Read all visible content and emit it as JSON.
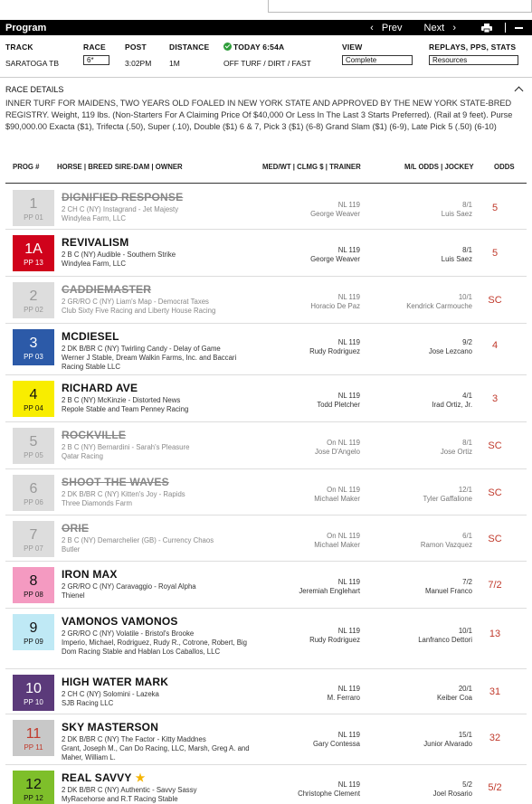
{
  "header": {
    "program_label": "Program",
    "prev_label": "Prev",
    "next_label": "Next"
  },
  "race_info": {
    "track_label": "TRACK",
    "track_value": "SARATOGA TB",
    "race_label": "RACE",
    "race_value": "6*",
    "post_label": "POST",
    "post_value": "3:02PM",
    "distance_label": "DISTANCE",
    "distance_value": "1M",
    "today_label": "TODAY 6:54A",
    "surface_value": "OFF TURF / DIRT / FAST",
    "view_label": "VIEW",
    "view_value": "Complete",
    "replays_label": "REPLAYS, PPS, STATS",
    "replays_value": "Resources"
  },
  "race_details": {
    "title": "RACE DETAILS",
    "text": "INNER TURF FOR MAIDENS, TWO YEARS OLD FOALED IN NEW YORK STATE AND APPROVED BY THE NEW YORK STATE-BRED REGISTRY. Weight, 119 lbs. (Non-Starters For A Claiming Price Of $40,000 Or Less In The Last 3 Starts Preferred). (Rail at 9 feet). Purse $90,000.00 Exacta ($1), Trifecta (.50), Super (.10), Double ($1) 6 & 7, Pick 3 ($1) (6-8) Grand Slam ($1) (6-9), Late Pick 5 (.50) (6-10)"
  },
  "table": {
    "col_prog": "PROG #",
    "col_horse": "HORSE | BREED SIRE-DAM | OWNER",
    "col_med": "MED/WT | CLMG $ | TRAINER",
    "col_ml": "M/L ODDS | JOCKEY",
    "col_odds": "ODDS"
  },
  "entries": [
    {
      "num": "1",
      "pp": "PP 01",
      "name": "DIGNIFIED RESPONSE",
      "breed": "2 CH C (NY) Instagrand - Jet Majesty",
      "owner": "Windylea Farm, LLC",
      "medwt": "NL 119",
      "trainer": "George Weaver",
      "ml": "8/1",
      "jockey": "Luis Saez",
      "odds": "5",
      "scratched": true,
      "color": "#ddd",
      "text": "#999"
    },
    {
      "num": "1A",
      "pp": "PP 13",
      "name": "REVIVALISM",
      "breed": "2 B C (NY) Audible - Southern Strike",
      "owner": "Windylea Farm, LLC",
      "medwt": "NL 119",
      "trainer": "George Weaver",
      "ml": "8/1",
      "jockey": "Luis Saez",
      "odds": "5",
      "scratched": false,
      "color": "#d0021b",
      "text": "#fff"
    },
    {
      "num": "2",
      "pp": "PP 02",
      "name": "CADDIEMASTER",
      "breed": "2 GR/RO C (NY) Liam's Map - Democrat Taxes",
      "owner": "Club Sixty Five Racing and Liberty House Racing",
      "medwt": "NL 119",
      "trainer": "Horacio De Paz",
      "ml": "10/1",
      "jockey": "Kendrick Carmouche",
      "odds": "SC",
      "scratched": true,
      "color": "#ddd",
      "text": "#999"
    },
    {
      "num": "3",
      "pp": "PP 03",
      "name": "MCDIESEL",
      "breed": "2 DK B/BR C (NY) Twirling Candy - Delay of Game",
      "owner": "Werner J Stable, Dream Walkin Farms, Inc. and Baccari Racing Stable LLC",
      "medwt": "NL 119",
      "trainer": "Rudy Rodriguez",
      "ml": "9/2",
      "jockey": "Jose Lezcano",
      "odds": "4",
      "scratched": false,
      "color": "#2c5aa8",
      "text": "#fff"
    },
    {
      "num": "4",
      "pp": "PP 04",
      "name": "RICHARD AVE",
      "breed": "2 B C (NY) McKinzie - Distorted News",
      "owner": "Repole Stable and Team Penney Racing",
      "medwt": "NL 119",
      "trainer": "Todd Pletcher",
      "ml": "4/1",
      "jockey": "Irad Ortiz, Jr.",
      "odds": "3",
      "scratched": false,
      "color": "#f8ed00",
      "text": "#111"
    },
    {
      "num": "5",
      "pp": "PP 05",
      "name": "ROCKVILLE",
      "breed": "2 B C (NY) Bernardini - Sarah's Pleasure",
      "owner": "Qatar Racing",
      "medwt": "On NL 119",
      "trainer": "Jose D'Angelo",
      "ml": "8/1",
      "jockey": "Jose Ortiz",
      "odds": "SC",
      "scratched": true,
      "color": "#ddd",
      "text": "#999"
    },
    {
      "num": "6",
      "pp": "PP 06",
      "name": "SHOOT THE WAVES",
      "breed": "2 DK B/BR C (NY) Kitten's Joy - Rapids",
      "owner": "Three Diamonds Farm",
      "medwt": "On NL 119",
      "trainer": "Michael Maker",
      "ml": "12/1",
      "jockey": "Tyler Gaffalione",
      "odds": "SC",
      "scratched": true,
      "color": "#ddd",
      "text": "#999"
    },
    {
      "num": "7",
      "pp": "PP 07",
      "name": "ORIE",
      "breed": "2 B C (NY) Demarchelier (GB) - Currency Chaos",
      "owner": "Butler",
      "medwt": "On NL 119",
      "trainer": "Michael Maker",
      "ml": "6/1",
      "jockey": "Ramon Vazquez",
      "odds": "SC",
      "scratched": true,
      "color": "#ddd",
      "text": "#999"
    },
    {
      "num": "8",
      "pp": "PP 08",
      "name": "IRON MAX",
      "breed": "2 GR/RO C (NY) Caravaggio - Royal Alpha",
      "owner": "Thienel",
      "medwt": "NL 119",
      "trainer": "Jeremiah Englehart",
      "ml": "7/2",
      "jockey": "Manuel Franco",
      "odds": "7/2",
      "scratched": false,
      "color": "#f49ac1",
      "text": "#111"
    },
    {
      "num": "9",
      "pp": "PP 09",
      "name": "VAMONOS VAMONOS",
      "breed": "2 GR/RO C (NY) Volatile - Bristol's Brooke",
      "owner": "Imperio, Michael, Rodriguez, Rudy R., Cotrone, Robert, Big Dom Racing Stable and Hablan Los Caballos, LLC",
      "medwt": "NL 119",
      "trainer": "Rudy Rodriguez",
      "ml": "10/1",
      "jockey": "Lanfranco Dettori",
      "odds": "13",
      "scratched": false,
      "color": "#bfe9f5",
      "text": "#111"
    },
    {
      "num": "10",
      "pp": "PP 10",
      "name": "HIGH WATER MARK",
      "breed": "2 CH C (NY) Solomini - Lazeka",
      "owner": "SJB Racing LLC",
      "medwt": "NL 119",
      "trainer": "M. Ferraro",
      "ml": "20/1",
      "jockey": "Keiber Coa",
      "odds": "31",
      "scratched": false,
      "color": "#5b3a7a",
      "text": "#fff"
    },
    {
      "num": "11",
      "pp": "PP 11",
      "name": "SKY MASTERSON",
      "breed": "2 DK B/BR C (NY) The Factor - Kitty Maddnes",
      "owner": "Grant, Joseph M., Can Do Racing, LLC, Marsh, Greg A. and Maher, William L.",
      "medwt": "NL 119",
      "trainer": "Gary Contessa",
      "ml": "15/1",
      "jockey": "Junior Alvarado",
      "odds": "32",
      "scratched": false,
      "color": "#c8c8c8",
      "text": "#c0392b"
    },
    {
      "num": "12",
      "pp": "PP 12",
      "name": "REAL SAVVY",
      "breed": "2 DK B/BR C (NY) Authentic - Savvy Sassy",
      "owner": "MyRacehorse and R.T Racing Stable",
      "medwt": "NL 119",
      "trainer": "Christophe Clement",
      "ml": "5/2",
      "jockey": "Joel Rosario",
      "odds": "5/2",
      "scratched": false,
      "color": "#7ebf2a",
      "text": "#111",
      "star": true
    }
  ]
}
